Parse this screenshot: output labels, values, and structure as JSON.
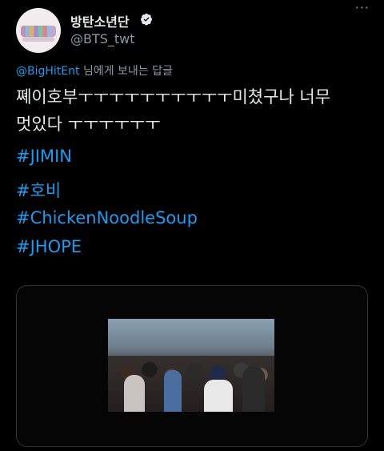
{
  "tweet": {
    "display_name": "방탄소년단",
    "handle": "@BTS_twt",
    "more_label": "···",
    "reply_to": {
      "mention": "@BigHitEnt",
      "suffix": " 님에게 보내는 답글"
    },
    "text_lines": [
      "쪠이호부ㅜㅜㅜㅜㅜㅜㅜㅜㅜㅜ미쳤구나 너무",
      "멋있다 ㅜㅜㅜㅜㅜㅜ"
    ],
    "hashtags": [
      "#JIMIN",
      "#호비",
      "#ChickenNoodleSoup",
      "#JHOPE"
    ]
  },
  "icons": {
    "verified": "verified-badge-icon",
    "more": "more-options-icon"
  },
  "colors": {
    "background": "#000000",
    "text": "#e7e9ea",
    "secondary": "#8b98a5",
    "link": "#1d9bf0"
  }
}
